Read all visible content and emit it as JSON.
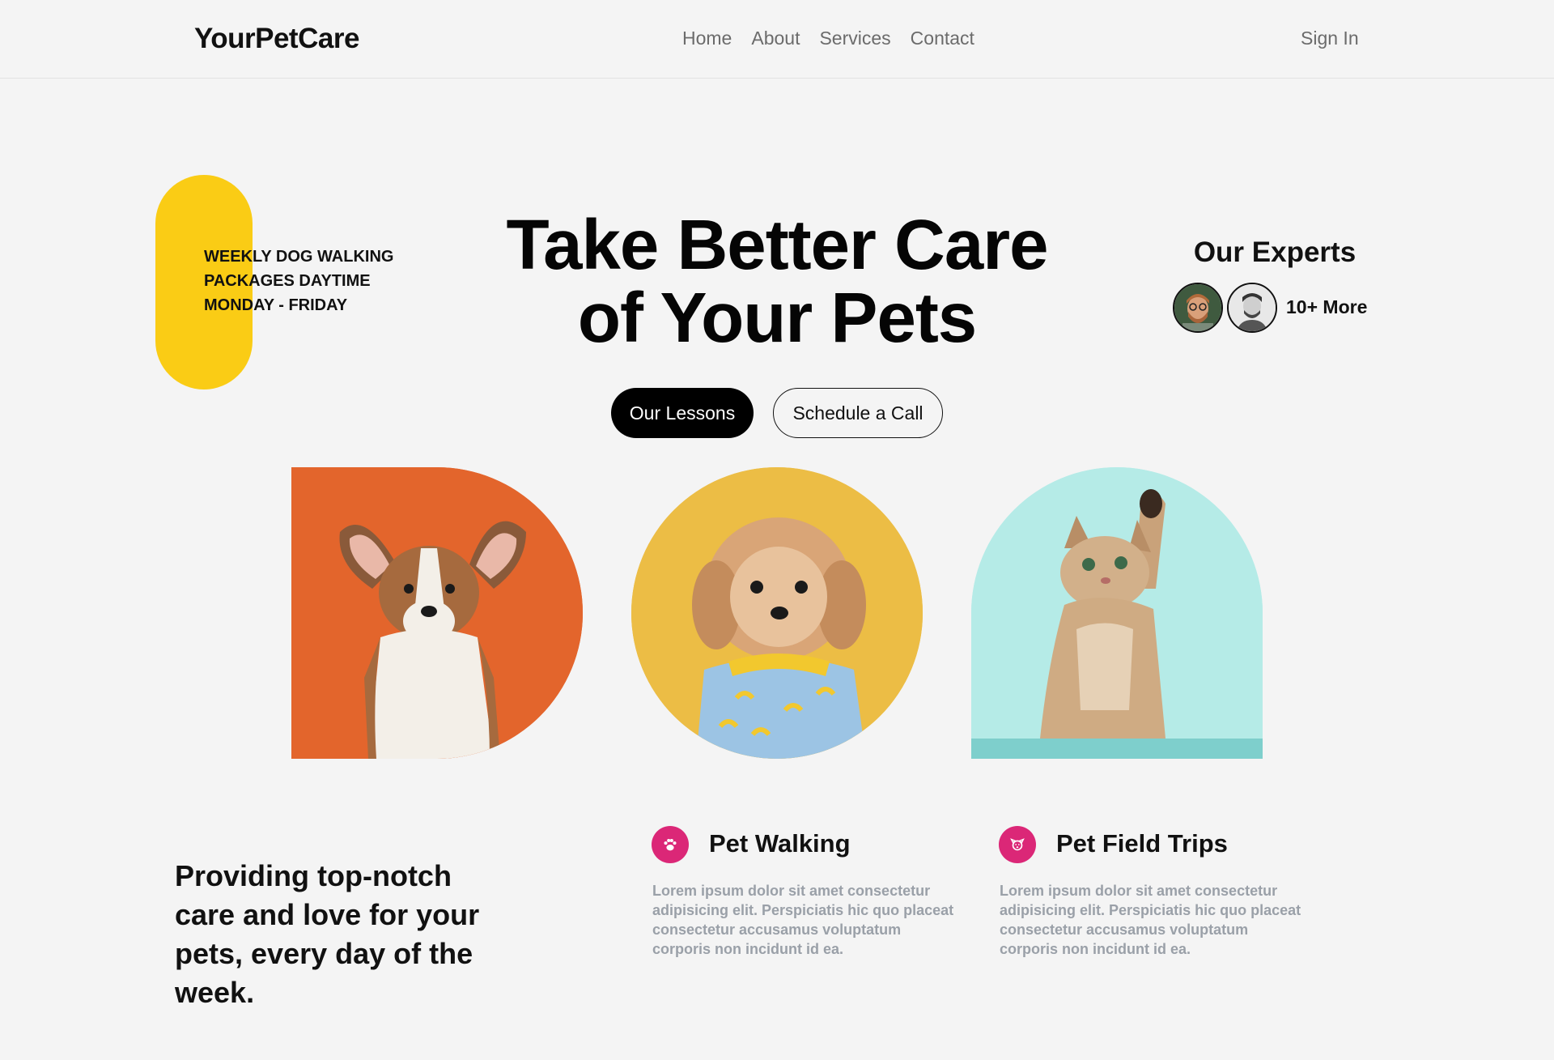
{
  "nav": {
    "logo": "YourPetCare",
    "links": [
      "Home",
      "About",
      "Services",
      "Contact"
    ],
    "sign_in": "Sign In"
  },
  "hero": {
    "note_lines": [
      "WEEKLY DOG WALKING",
      "PACKAGES DAYTIME",
      "MONDAY - FRIDAY"
    ],
    "title_line1": "Take Better Care",
    "title_line2": "of Your Pets",
    "primary_button": "Our Lessons",
    "secondary_button": "Schedule a Call",
    "accent_color": "#facc15"
  },
  "experts": {
    "title": "Our Experts",
    "more": "10+ More"
  },
  "pets": [
    {
      "name": "corgi-puppy",
      "bg": "#e3652c"
    },
    {
      "name": "shih-tzu-dog",
      "bg": "#ecbd45"
    },
    {
      "name": "kitten",
      "bg": "#b5ebe7"
    }
  ],
  "tagline": "Providing top-notch care and love for your pets, every day of the week.",
  "services": [
    {
      "icon": "paw-icon",
      "title": "Pet Walking",
      "desc": "Lorem ipsum dolor sit amet consectetur adipisicing elit. Perspiciatis hic quo placeat consectetur accusamus voluptatum corporis non incidunt id ea."
    },
    {
      "icon": "dog-face-icon",
      "title": "Pet Field Trips",
      "desc": "Lorem ipsum dolor sit amet consectetur adipisicing elit. Perspiciatis hic quo placeat consectetur accusamus voluptatum corporis non incidunt id ea."
    }
  ],
  "service_icon_color": "#db2777"
}
